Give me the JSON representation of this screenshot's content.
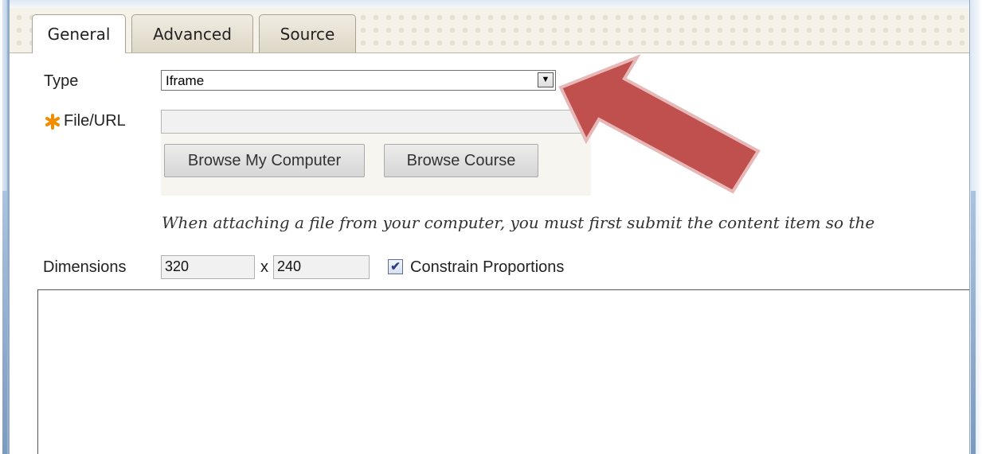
{
  "tabs": [
    {
      "label": "General",
      "active": true
    },
    {
      "label": "Advanced",
      "active": false
    },
    {
      "label": "Source",
      "active": false
    }
  ],
  "form": {
    "type_label": "Type",
    "type_value": "Iframe",
    "file_label": "File/URL",
    "file_value": "",
    "browse_computer_label": "Browse My Computer",
    "browse_course_label": "Browse Course",
    "note": "When attaching a file from your computer, you must first submit the content item so the",
    "dimensions_label": "Dimensions",
    "width_value": "320",
    "times_symbol": "x",
    "height_value": "240",
    "constrain_label": "Constrain Proportions",
    "constrain_checked": true
  },
  "icons": {
    "required": "asterisk-icon",
    "dropdown": "chevron-down-icon",
    "callout": "arrow-icon"
  },
  "colors": {
    "required_star": "#f28c00",
    "arrow_fill": "#c0504d",
    "arrow_stroke": "#e6b9b8",
    "tab_strip": "#f5f2ea"
  }
}
